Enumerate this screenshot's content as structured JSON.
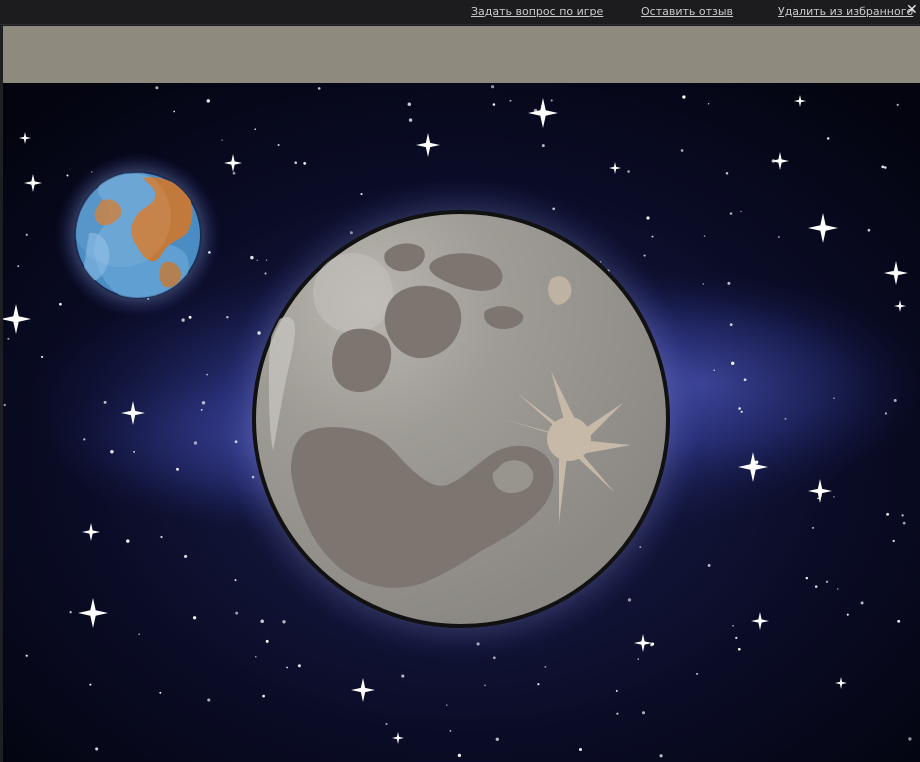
{
  "header": {
    "links": {
      "ask_question": "Задать вопрос по игре",
      "leave_review": "Оставить отзыв",
      "remove_favorite": "Удалить из избранного"
    },
    "close_icon": "close-icon"
  },
  "toolbar": {
    "color": "#8e8a7e"
  },
  "game": {
    "scene": "space",
    "objects": [
      "moon",
      "earth",
      "stars",
      "nebula"
    ],
    "colors": {
      "space": "#05061a",
      "nebula": "#3b45a8",
      "moon": "#9a9893",
      "moon_mare": "#7d756f",
      "earth_ocean": "#4a8cc4",
      "earth_land": "#c27a3c"
    }
  }
}
